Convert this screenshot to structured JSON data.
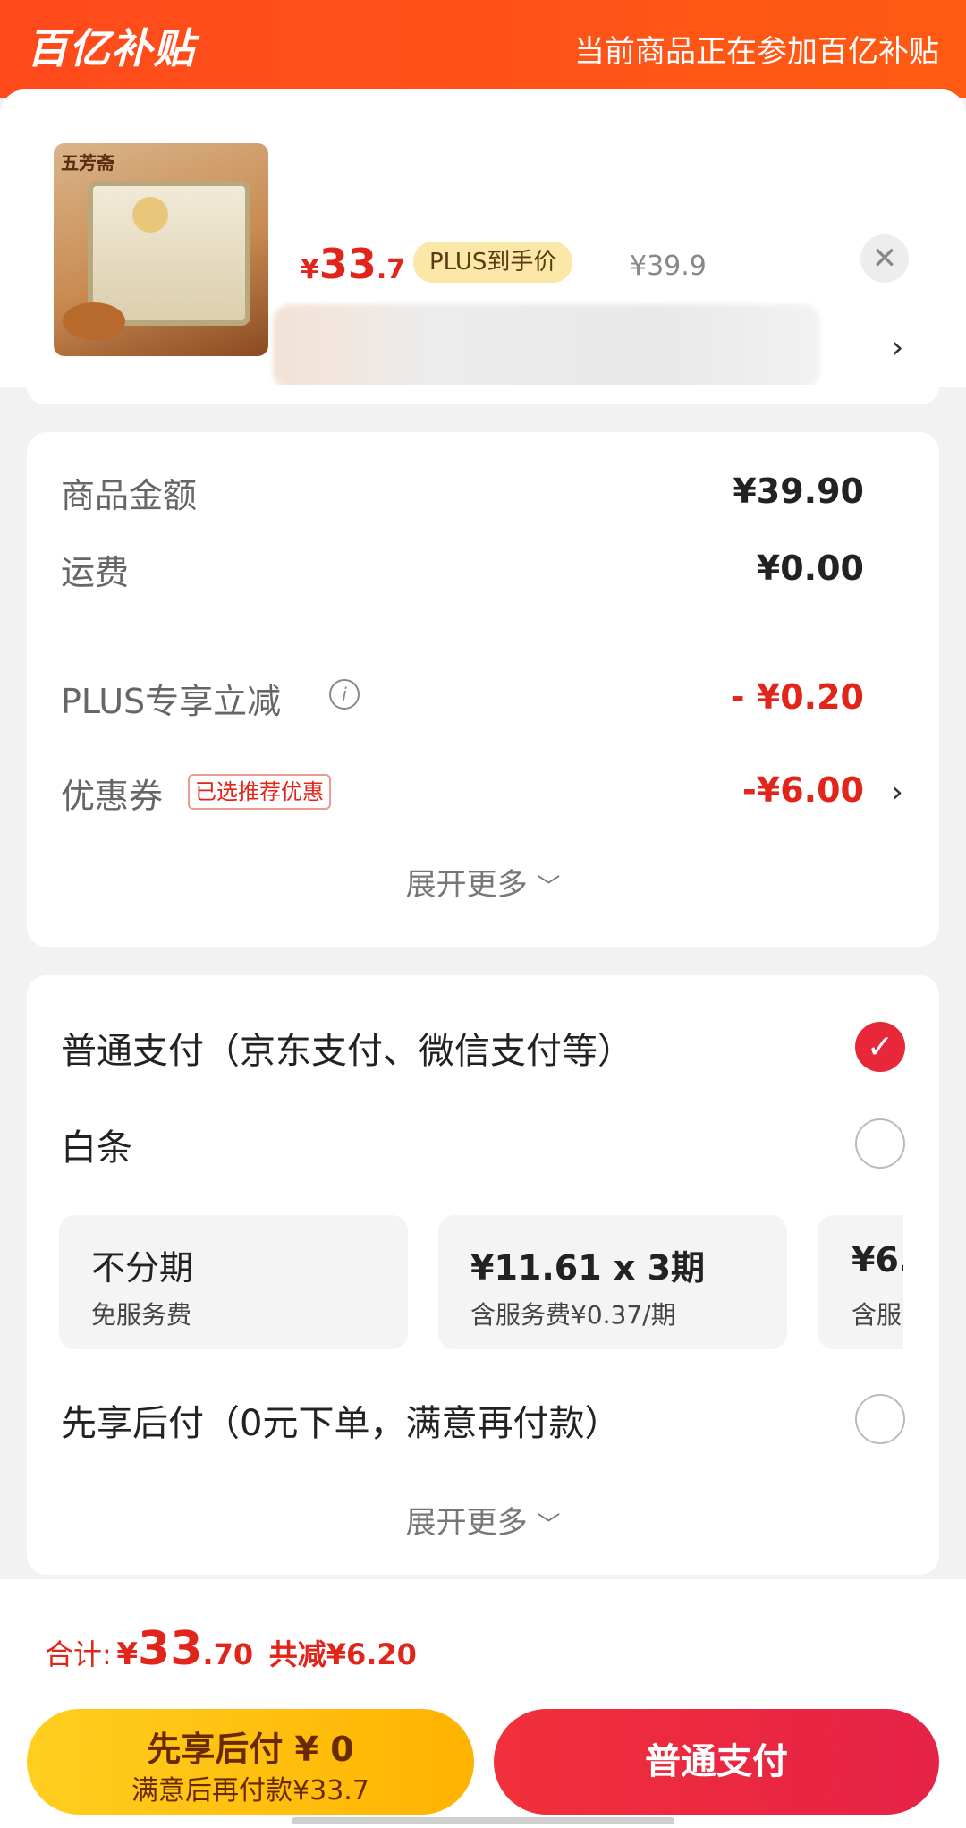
{
  "header": {
    "logo": "百亿补贴",
    "promo_text": "当前商品正在参加百亿补贴"
  },
  "product": {
    "thumb_brand": "五芳斋",
    "price_symbol": "¥",
    "price_int": "33",
    "price_dec": ".7",
    "plus_tag": "PLUS到手价",
    "original_price": "¥39.9",
    "close_icon": "close-icon",
    "chevron_icon": "chevron-right-icon"
  },
  "summary": {
    "goods_amount_label": "商品金额",
    "goods_amount_value": "¥39.90",
    "shipping_label": "运费",
    "shipping_value": "¥0.00",
    "plus_discount_label": "PLUS专享立减",
    "plus_discount_value": "- ¥0.20",
    "coupon_label": "优惠券",
    "coupon_tag": "已选推荐优惠",
    "coupon_value": "-¥6.00",
    "expand_label": "展开更多"
  },
  "payment": {
    "normal_label": "普通支付（京东支付、微信支付等）",
    "baitiao_label": "白条",
    "plans": [
      {
        "title": "不分期",
        "sub": "免服务费"
      },
      {
        "title": "¥11.61 x 3期",
        "sub": "含服务费¥0.37/期"
      },
      {
        "title": "¥6.",
        "sub": "含服"
      }
    ],
    "later_label": "先享后付（0元下单，满意再付款）",
    "expand_label": "展开更多"
  },
  "total": {
    "label": "合计:",
    "symbol": "¥",
    "int": "33",
    "dec": ".70",
    "saved": "共减¥6.20"
  },
  "actions": {
    "later_line1": "先享后付 ¥ 0",
    "later_line2": "满意后再付款¥33.7",
    "pay_label": "普通支付"
  },
  "colors": {
    "accent_red": "#e1251b",
    "header_orange": "#ff4a1c",
    "later_yellow": "#ffc107"
  }
}
